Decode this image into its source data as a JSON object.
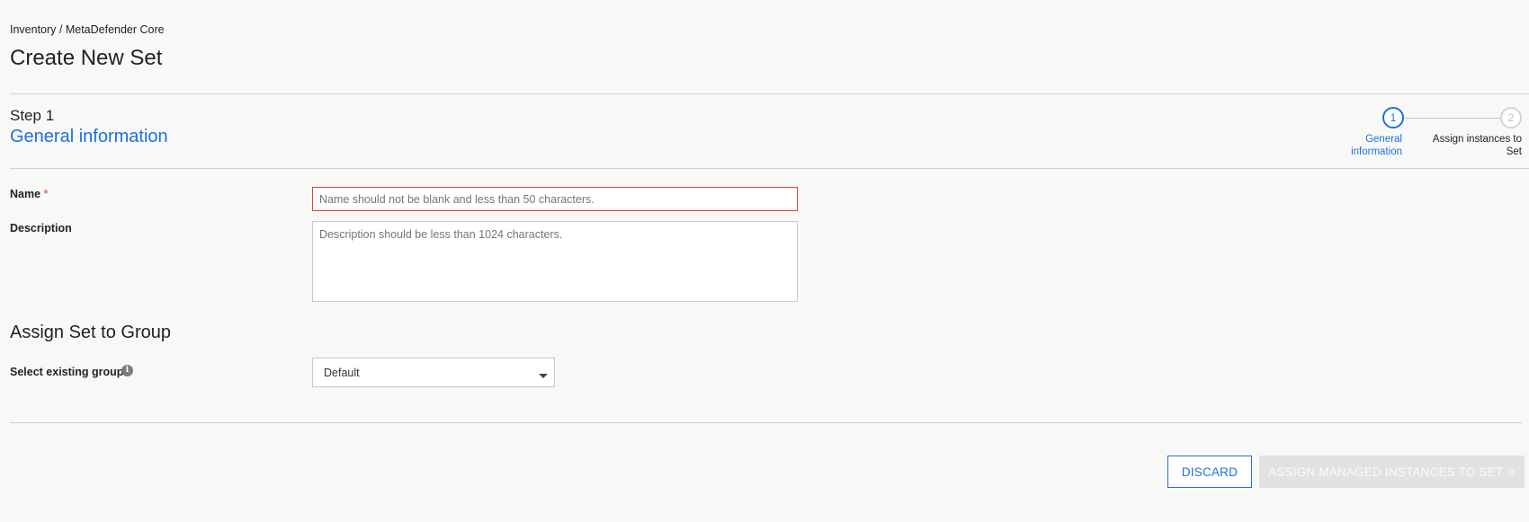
{
  "breadcrumb": "Inventory / MetaDefender Core",
  "page_title": "Create New Set",
  "step": {
    "number_label": "Step 1",
    "title": "General information"
  },
  "stepper": {
    "steps": [
      {
        "number": "1",
        "label": "General information",
        "state": "active"
      },
      {
        "number": "2",
        "label": "Assign instances to Set",
        "state": "inactive"
      }
    ],
    "active_color": "#1f6fe0"
  },
  "form": {
    "name_label": "Name",
    "name_required_marker": "*",
    "name_placeholder": "Name should not be blank and less than 50 characters.",
    "name_value": "",
    "description_label": "Description",
    "description_placeholder": "Description should be less than 1024 characters.",
    "description_value": ""
  },
  "group": {
    "section_title": "Assign Set to Group",
    "select_label": "Select existing group",
    "info_icon": "info-icon",
    "selected_value": "Default"
  },
  "actions": {
    "discard_label": "DISCARD",
    "assign_label": "ASSIGN MANAGED INSTANCES TO SET",
    "assign_icon": "double-chevron-right-icon",
    "assign_enabled": false
  },
  "colors": {
    "accent": "#1f6fe0",
    "error_border": "#d9472f",
    "required": "#e03c2c"
  }
}
